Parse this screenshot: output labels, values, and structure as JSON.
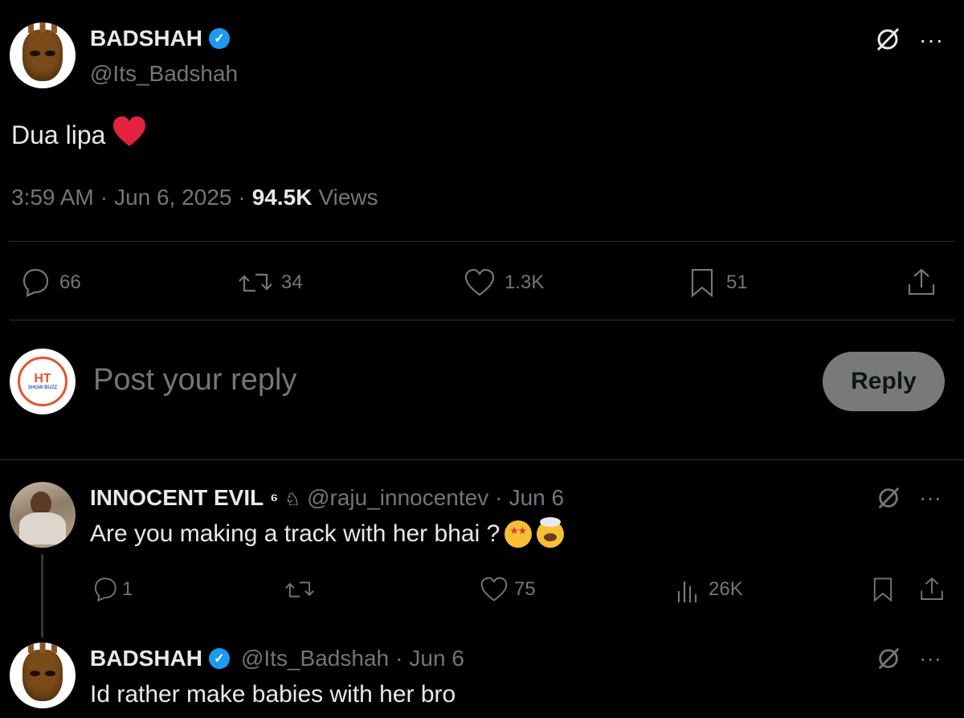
{
  "tweet": {
    "author_name": "BADSHAH",
    "author_handle": "@Its_Badshah",
    "text": "Dua lipa",
    "heart_emoji": "❤",
    "time": "3:59 AM",
    "date": "Jun 6, 2025",
    "views_count": "94.5K",
    "views_label": "Views",
    "sep": "·"
  },
  "actions": {
    "replies": "66",
    "reposts": "34",
    "likes": "1.3K",
    "bookmarks": "51"
  },
  "composer": {
    "placeholder": "Post your reply",
    "button": "Reply",
    "avatar_text": "HT",
    "avatar_subtext": "SHOW BUZZ"
  },
  "replies": [
    {
      "author_name": "INNOCENT EVIL",
      "name_suffix": "⁶",
      "author_handle": "@raju_innocentev",
      "date": "Jun 6",
      "text": "Are you making a track with her bhai ?",
      "replies": "1",
      "likes": "75",
      "views": "26K"
    },
    {
      "author_name": "BADSHAH",
      "author_handle": "@Its_Badshah",
      "date": "Jun 6",
      "text": "Id rather make babies with her bro"
    }
  ],
  "colors": {
    "background": "#000000",
    "text": "#e7e9ea",
    "muted": "#71767b",
    "verified": "#1d9bf0",
    "heart": "#f91880",
    "divider": "#2f3336"
  }
}
